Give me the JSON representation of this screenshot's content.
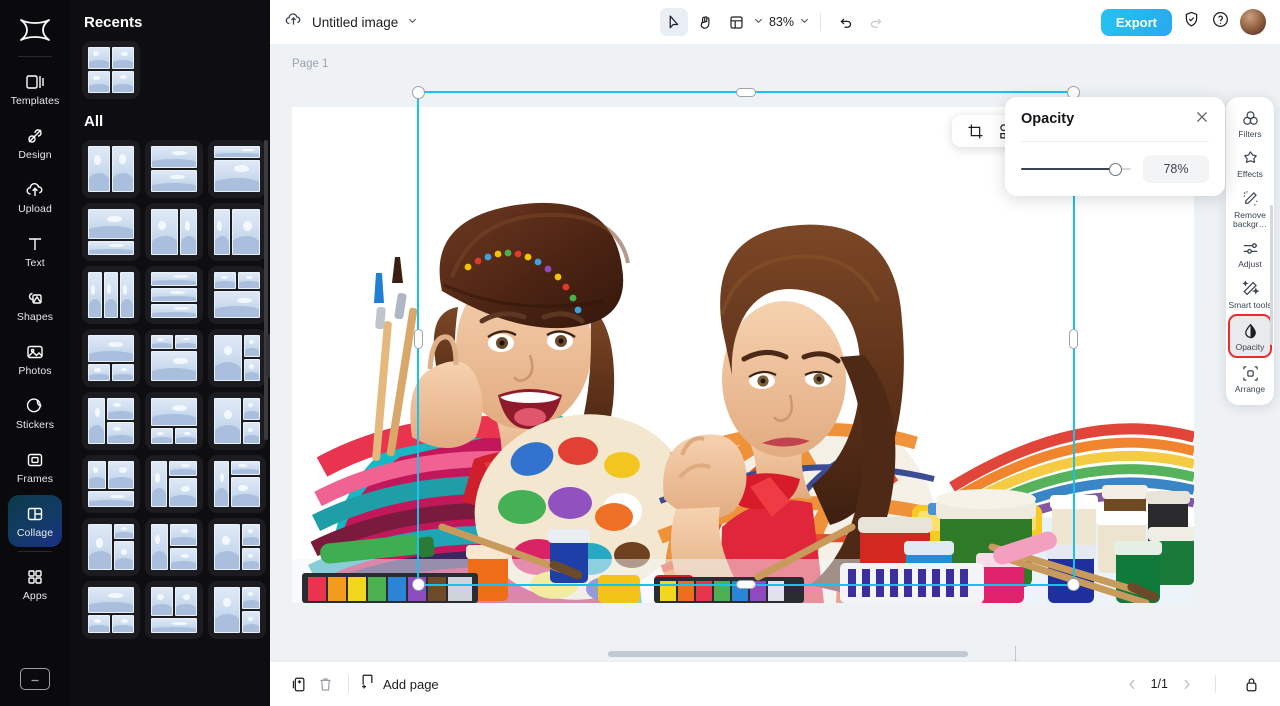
{
  "app": {
    "logo_icon": "hourglass-logo-icon"
  },
  "left_rail": {
    "items": [
      {
        "label": "Templates",
        "icon": "templates-icon",
        "active": false
      },
      {
        "label": "Design",
        "icon": "design-icon",
        "active": false
      },
      {
        "label": "Upload",
        "icon": "upload-cloud-icon",
        "active": false
      },
      {
        "label": "Text",
        "icon": "text-icon",
        "active": false
      },
      {
        "label": "Shapes",
        "icon": "shapes-icon",
        "active": false
      },
      {
        "label": "Photos",
        "icon": "photos-icon",
        "active": false
      },
      {
        "label": "Stickers",
        "icon": "stickers-icon",
        "active": false
      },
      {
        "label": "Frames",
        "icon": "frames-icon",
        "active": false
      },
      {
        "label": "Collage",
        "icon": "collage-icon",
        "active": true
      },
      {
        "label": "Apps",
        "icon": "apps-grid-icon",
        "active": false
      }
    ],
    "bottom_icon": "keyboard-shortcuts-icon",
    "active_color": "#123b66"
  },
  "panel": {
    "recents_title": "Recents",
    "all_title": "All",
    "recents": [
      {
        "name": "collage-2x2",
        "layout": "2x2"
      }
    ],
    "all_layouts": [
      "2v",
      "2h",
      "1top-1bot-wide",
      "1top-1bot-small",
      "3v-a",
      "3v-b",
      "3v-equal",
      "3h-equal",
      "2x2-top",
      "1top-2bot",
      "2top-1bot",
      "1l-2r",
      "2l-1r",
      "1top-2bot-b",
      "1l-2r-b",
      "1l-1r-split",
      "2top-1bot-b",
      "1l-2r-c",
      "2top-1bot-c",
      "1l-2r-d",
      "2top-1bot-d",
      "1top-2bot-c",
      "2v-1bot",
      "1l-2r-e"
    ]
  },
  "topbar": {
    "cloud_icon": "cloud-save-icon",
    "doc_title": "Untitled image",
    "doc_chevron_icon": "chevron-down-icon",
    "tools": [
      {
        "name": "select-tool",
        "icon": "cursor-arrow-icon",
        "selected": true
      },
      {
        "name": "hand-tool",
        "icon": "hand-icon",
        "selected": false
      },
      {
        "name": "layout-tool",
        "icon": "layout-panel-icon",
        "selected": false
      }
    ],
    "zoom_level": "83%",
    "zoom_chevron_icon": "chevron-down-icon",
    "undo_icon": "undo-arrow-icon",
    "redo_icon": "redo-arrow-icon",
    "export_label": "Export",
    "shield_icon": "shield-check-icon",
    "help_icon": "help-circle-icon",
    "avatar_name": "user-avatar",
    "export_color": "#2ab6f0"
  },
  "canvas": {
    "page_label": "Page 1",
    "selection_color": "#17c2ee",
    "rotate_icon": "rotate-icon"
  },
  "object_toolbar": {
    "buttons": [
      {
        "name": "crop-button",
        "icon": "crop-icon"
      },
      {
        "name": "replace-button",
        "icon": "replace-shape-icon"
      },
      {
        "name": "duplicate-button",
        "icon": "duplicate-icon"
      },
      {
        "name": "more-button",
        "icon": "ellipsis-icon"
      }
    ]
  },
  "opacity_panel": {
    "title": "Opacity",
    "close_icon": "close-icon",
    "value": "78%",
    "slider_percent": 78
  },
  "right_rail": {
    "items": [
      {
        "label": "Filters",
        "icon": "filters-circles-icon",
        "active": false
      },
      {
        "label": "Effects",
        "icon": "effects-sparkle-icon",
        "active": false
      },
      {
        "label": "Remove backgr…",
        "icon": "remove-background-icon",
        "active": false
      },
      {
        "label": "Adjust",
        "icon": "adjust-sliders-icon",
        "active": false
      },
      {
        "label": "Smart tools",
        "icon": "smart-tools-wand-icon",
        "active": false
      },
      {
        "label": "Opacity",
        "icon": "opacity-droplet-icon",
        "active": true
      },
      {
        "label": "Arrange",
        "icon": "arrange-icon",
        "active": false
      }
    ],
    "active_outline_color": "#ee2b2b"
  },
  "bottombar": {
    "duplicate_icon": "duplicate-page-icon",
    "delete_icon": "trash-icon",
    "add_page_label": "Add page",
    "add_page_icon": "add-page-icon",
    "prev_icon": "chevron-left-icon",
    "next_icon": "chevron-right-icon",
    "page_indicator": "1/1",
    "lock_icon": "lock-icon"
  }
}
